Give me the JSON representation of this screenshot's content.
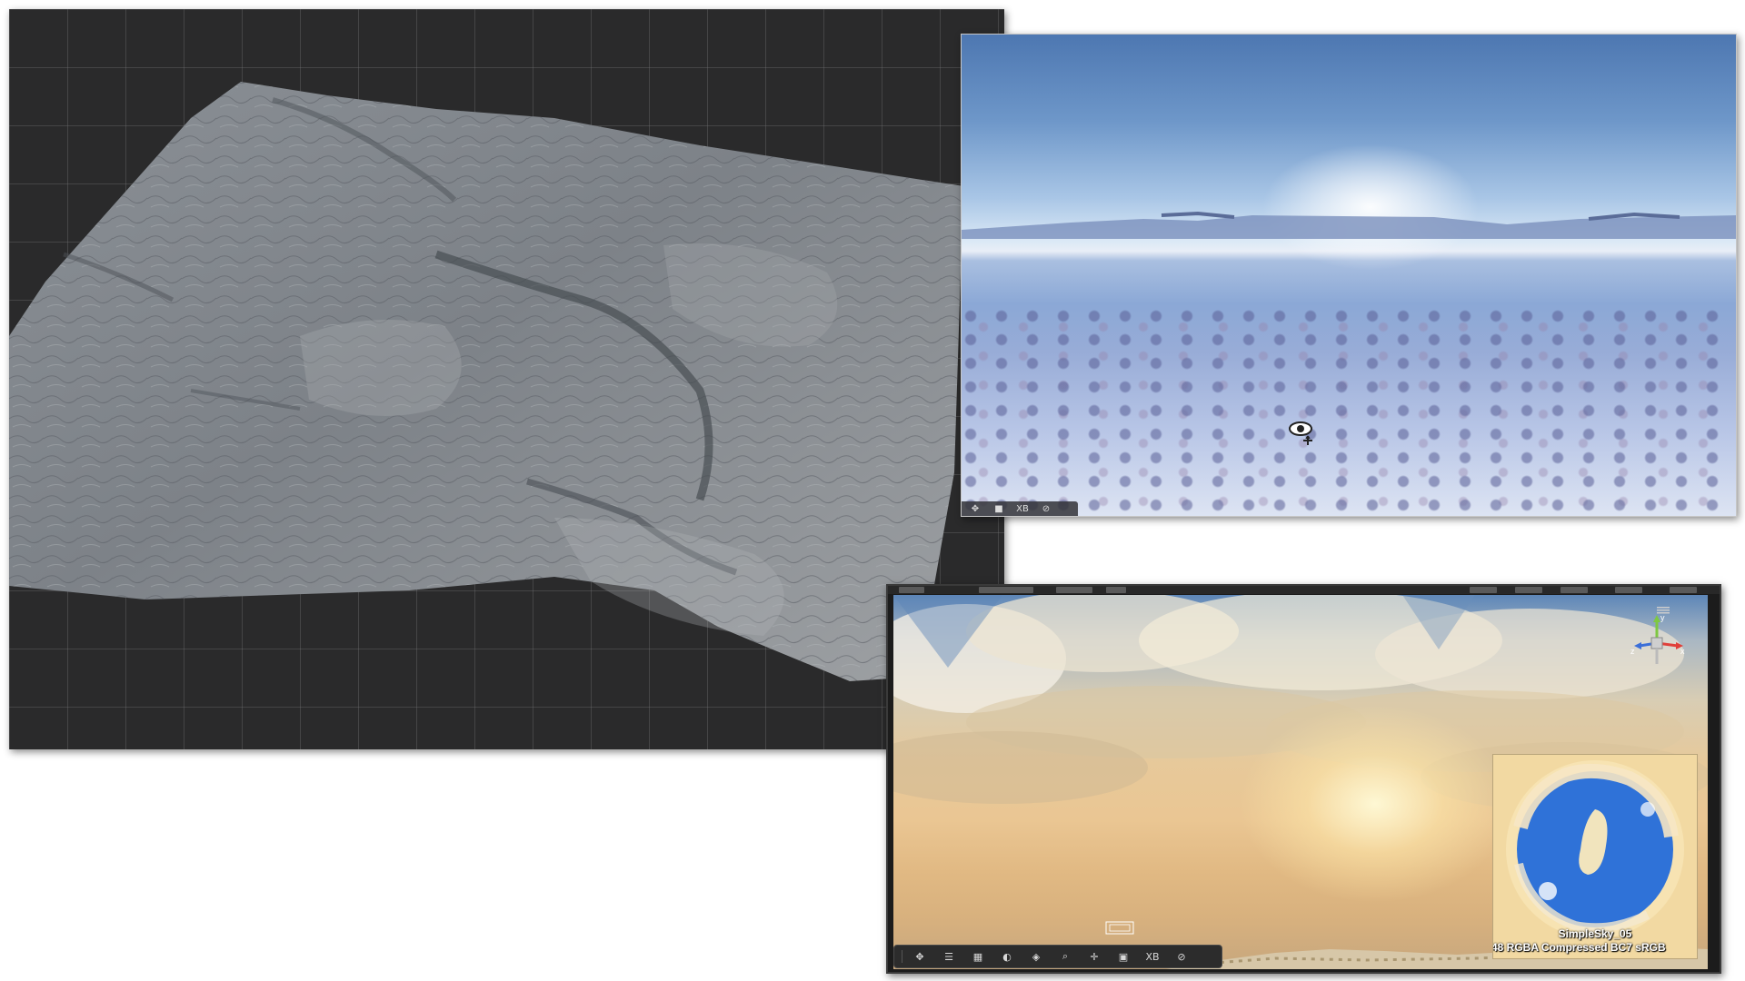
{
  "terrain_viewport": {
    "background_color": "#2a2a2b",
    "mesh_color": "#7c8187"
  },
  "snow_viewport": {
    "toolbar": {
      "move_icon": "move-icon",
      "camera_icon": "camera-icon",
      "xb_label": "XB",
      "compass_icon": "compass-icon"
    },
    "gizmo": "eye-gizmo-icon"
  },
  "sky_viewport": {
    "toolbar": {
      "xb_label": "XB",
      "icons": [
        "move-tool-icon",
        "align-icon",
        "grid-icon",
        "lighting-icon",
        "layers-icon",
        "search-icon",
        "pivot-icon",
        "camera-icon",
        "compass-icon"
      ]
    },
    "axis_labels": {
      "y": "y",
      "x": "x",
      "z": "z"
    },
    "texture_preview": {
      "name": "SimpleSky_05",
      "info": ")48  RGBA Compressed BC7 sRGB"
    }
  }
}
